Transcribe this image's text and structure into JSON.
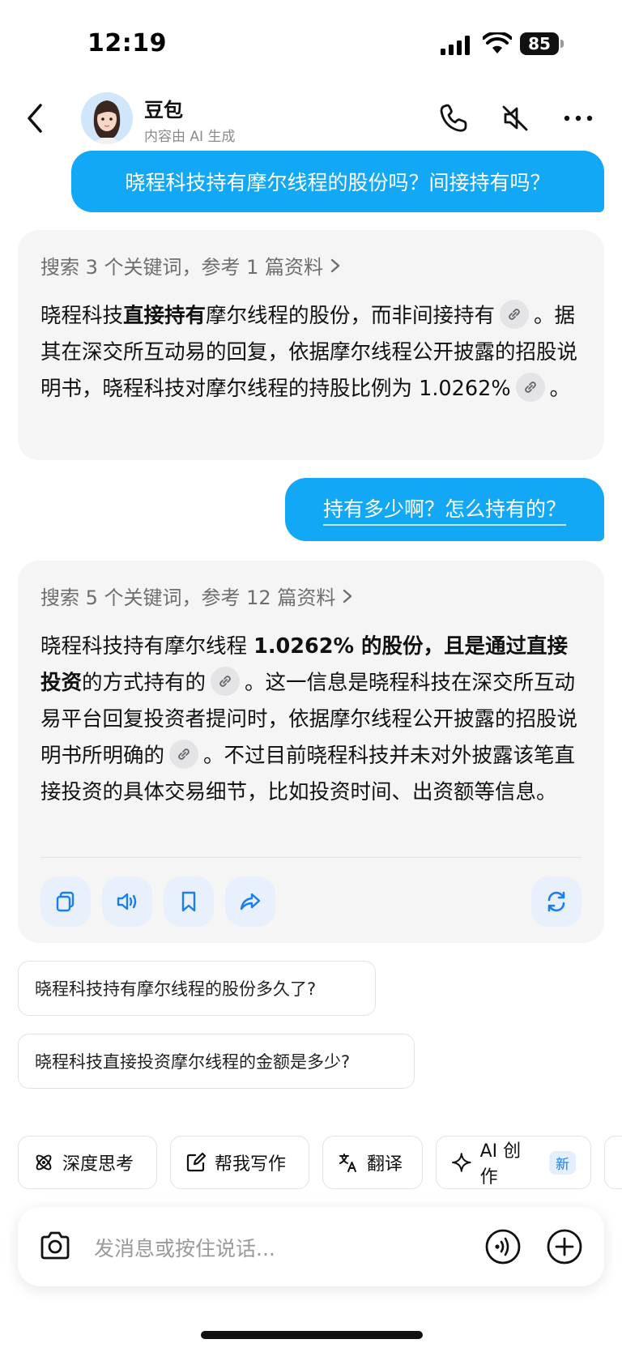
{
  "status_bar": {
    "time": "12:19",
    "battery": "85"
  },
  "header": {
    "title": "豆包",
    "subtitle": "内容由 AI 生成",
    "icons": [
      "back-icon",
      "phone-icon",
      "mute-icon",
      "more-icon"
    ]
  },
  "conversation": {
    "user_messages": [
      "晓程科技持有摩尔线程的股份吗？间接持有吗？",
      "持有多少啊？怎么持有的？"
    ],
    "ai_replies": [
      {
        "search": "搜索 3 个关键词，参考 1 篇资料",
        "p1": "晓程科技",
        "p1b": "直接持有",
        "p2": "摩尔线程的股份，而非间接持有",
        "p3": "。据其在深交所互动易的回复，依据摩尔线程公开披露的招股说明书，晓程科技对摩尔线程的持股比例为 1.0262%",
        "p4": "。"
      },
      {
        "search": "搜索 5 个关键词，参考 12 篇资料",
        "p1": "晓程科技持有摩尔线程 ",
        "p1b": "1.0262% 的股份，且是通过直接投资",
        "p2": "的方式持有的",
        "p3": "。这一信息是晓程科技在深交所互动易平台回复投资者提问时，依据摩尔线程公开披露的招股说明书所明确的",
        "p4": "。不过目前晓程科技并未对外披露该笔直接投资的具体交易细节，比如投资时间、出资额等信息。"
      }
    ]
  },
  "suggestions": [
    "晓程科技持有摩尔线程的股份多久了?",
    "晓程科技直接投资摩尔线程的金额是多少?"
  ],
  "tools": [
    {
      "label": "深度思考",
      "icon": "atom-icon"
    },
    {
      "label": "帮我写作",
      "icon": "edit-icon"
    },
    {
      "label": "翻译",
      "icon": "translate-icon"
    },
    {
      "label": "AI 创作",
      "icon": "sparkle-icon",
      "badge": "新"
    }
  ],
  "input": {
    "placeholder": "发消息或按住说话..."
  },
  "colors": {
    "accent": "#13a8f5",
    "link_blue": "#1a7ef0",
    "card_bg": "#f5f5f6"
  }
}
